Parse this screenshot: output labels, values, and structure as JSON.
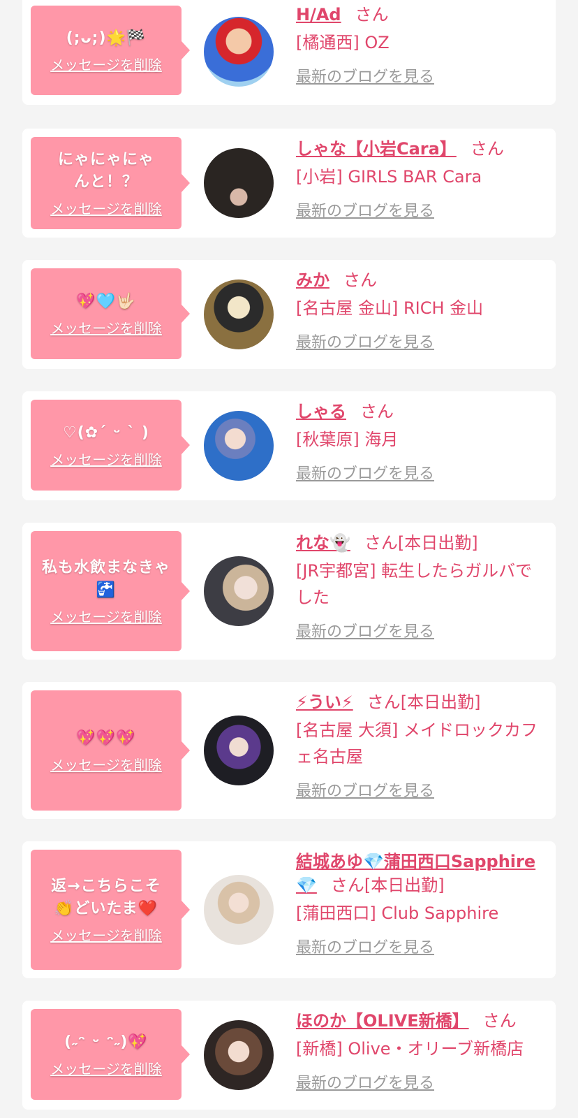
{
  "delete_label": "メッセージを削除",
  "honorific": "さん",
  "blog_label": "最新のブログを見る",
  "colors": {
    "bubble": "#ff97a8",
    "link": "#e0466b",
    "muted": "#9a9a9a"
  },
  "messages": [
    {
      "message": "(;ᴗ;)🌟🏁",
      "name": "H/Ad",
      "status": "",
      "shop": "[橘通西] OZ"
    },
    {
      "message": "にゃにゃにゃんと！？",
      "name": "しゃな【小岩Cara】",
      "status": "",
      "shop": "[小岩] GIRLS BAR Cara"
    },
    {
      "message": "💖🩵🤟🏻",
      "name": "みか",
      "status": "",
      "shop": "[名古屋 金山] RICH 金山"
    },
    {
      "message": "♡(✿´ ᵕ ` )",
      "name": "しゃる",
      "status": "",
      "shop": "[秋葉原] 海月"
    },
    {
      "message": "私も水飲まなきゃ🚰",
      "name": "れな👻",
      "status": "[本日出勤]",
      "shop": "[JR宇都宮] 転生したらガルバでした"
    },
    {
      "message": "💖💖💖",
      "name": "⚡うい⚡",
      "status": "[本日出勤]",
      "shop": "[名古屋 大須] メイドロックカフェ名古屋"
    },
    {
      "message": "返→こちらこそ👏どいたま❤️",
      "name": "結城あゆ💎蒲田西口Sapphire💎",
      "status": "[本日出勤]",
      "shop": "[蒲田西口] Club Sapphire"
    },
    {
      "message": "(˶ᵔ ᵕ ᵔ˶)💖",
      "name": "ほのか【OLIVE新橋】",
      "status": "",
      "shop": "[新橋] Olive・オリーブ新橋店"
    }
  ]
}
